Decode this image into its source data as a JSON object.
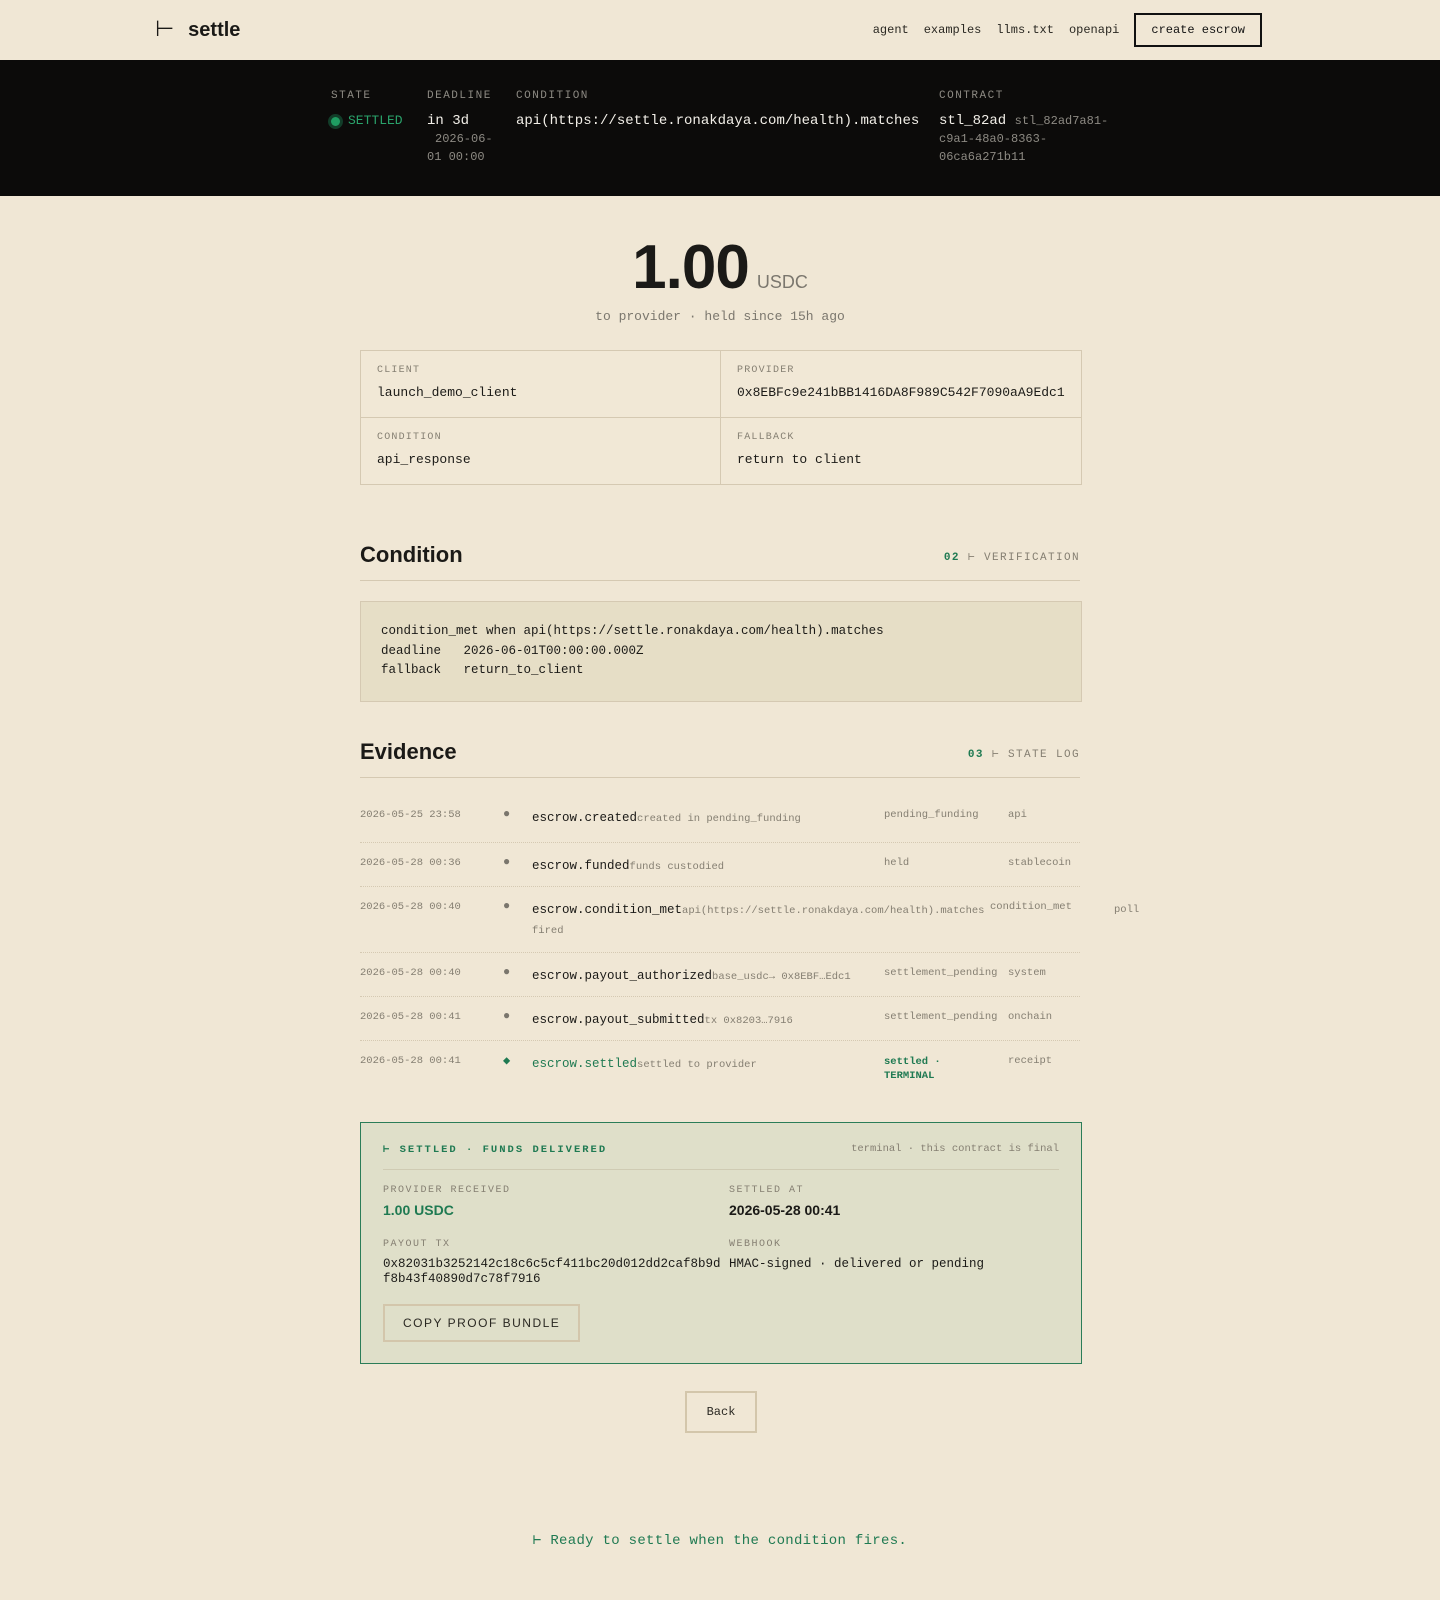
{
  "brand": {
    "mark": "⊢",
    "name": "settle"
  },
  "nav": {
    "links": [
      "agent",
      "examples",
      "llms.txt",
      "openapi"
    ],
    "cta": "create escrow"
  },
  "band": {
    "state_label": "STATE",
    "state_value": "SETTLED",
    "deadline_label": "DEADLINE",
    "deadline_value": "in 3d",
    "deadline_sub1": "2026-06-",
    "deadline_sub2": "01 00:00",
    "condition_label": "CONDITION",
    "condition_value": "api(https://settle.ronakdaya.com/health).matches",
    "contract_label": "CONTRACT",
    "contract_short": "stl_82ad",
    "contract_id1": "stl_82ad7a81-",
    "contract_id2": "c9a1-48a0-8363-",
    "contract_id3": "06ca6a271b11"
  },
  "amount": {
    "value": "1.00",
    "unit": "USDC",
    "meta": "to provider · held since 15h ago"
  },
  "info": {
    "client_label": "CLIENT",
    "client_value": "launch_demo_client",
    "provider_label": "PROVIDER",
    "provider_value": "0x8EBFc9e241bBB1416DA8F989C542F7090aA9Edc1",
    "condition_label": "CONDITION",
    "condition_value": "api_response",
    "fallback_label": "FALLBACK",
    "fallback_value": "return to client"
  },
  "condition_section": {
    "title": "Condition",
    "tag_num": "02",
    "tag_text": "⊢ VERIFICATION",
    "code": "condition_met when api(https://settle.ronakdaya.com/health).matches\ndeadline   2026-06-01T00:00:00.000Z\nfallback   return_to_client"
  },
  "evidence_section": {
    "title": "Evidence",
    "tag_num": "03",
    "tag_text": "⊢ STATE LOG",
    "rows": [
      {
        "ts": "2026-05-25 23:58",
        "bullet": "●",
        "name": "escrow.created",
        "desc": "created in pending_funding",
        "state": "pending_funding",
        "source": "api"
      },
      {
        "ts": "2026-05-28 00:36",
        "bullet": "●",
        "name": "escrow.funded",
        "desc": "funds custodied",
        "state": "held",
        "source": "stablecoin"
      },
      {
        "ts": "2026-05-28 00:40",
        "bullet": "●",
        "name": "escrow.condition_met",
        "desc": "api(https://settle.ronakdaya.com/health).matches fired",
        "state": "condition_met",
        "source": "poll"
      },
      {
        "ts": "2026-05-28 00:40",
        "bullet": "●",
        "name": "escrow.payout_authorized",
        "desc": "base_usdc→ 0x8EBF…Edc1",
        "state": "settlement_pending",
        "source": "system"
      },
      {
        "ts": "2026-05-28 00:41",
        "bullet": "●",
        "name": "escrow.payout_submitted",
        "desc": "tx 0x8203…7916",
        "state": "settlement_pending",
        "source": "onchain"
      },
      {
        "ts": "2026-05-28 00:41",
        "bullet": "◆",
        "name": "escrow.settled",
        "desc": "settled to provider",
        "state": "settled ·",
        "state2": "TERMINAL",
        "source": "receipt"
      }
    ]
  },
  "settled": {
    "header": "⊢ SETTLED · FUNDS DELIVERED",
    "header_right": "terminal · this contract is final",
    "received_label": "PROVIDER RECEIVED",
    "received_value": "1.00 USDC",
    "settled_at_label": "SETTLED AT",
    "settled_at_value": "2026-05-28 00:41",
    "tx_label": "PAYOUT TX",
    "tx_line1": "0x82031b3252142c18c6c5cf411bc20d012dd2caf8b9d",
    "tx_line2": "f8b43f40890d7c78f7916",
    "webhook_label": "WEBHOOK",
    "webhook_value": "HMAC-signed · delivered or pending",
    "copy_button": "COPY PROOF BUNDLE"
  },
  "back_button": "Back",
  "footer": "⊢ Ready to settle when the condition fires.",
  "colors": {
    "accent": "#1f7a52",
    "background": "#f0e7d5",
    "band": "#0c0b0a"
  }
}
